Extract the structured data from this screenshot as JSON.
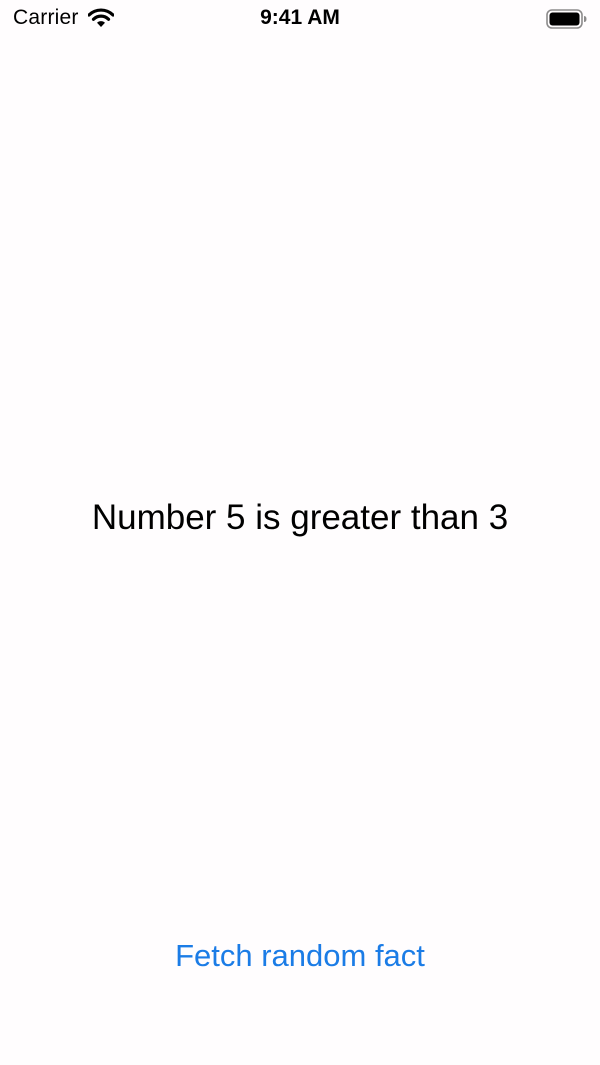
{
  "status_bar": {
    "carrier": "Carrier",
    "time": "9:41 AM",
    "icons": [
      "wifi-icon",
      "battery-icon"
    ]
  },
  "main": {
    "fact_text": "Number 5 is greater than 3"
  },
  "actions": {
    "fetch_label": "Fetch random fact"
  },
  "colors": {
    "background": "#fffdfe",
    "accent": "#1b7ce6",
    "text": "#000000"
  }
}
